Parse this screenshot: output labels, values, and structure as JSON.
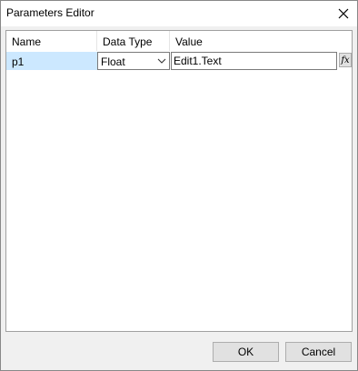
{
  "window": {
    "title": "Parameters Editor"
  },
  "grid": {
    "columns": [
      "Name",
      "Data Type",
      "Value"
    ],
    "rows": [
      {
        "name": "p1",
        "data_type": "Float",
        "value": "Edit1.Text",
        "expr_button": "fx"
      }
    ]
  },
  "buttons": {
    "ok": "OK",
    "cancel": "Cancel"
  },
  "icons": {
    "close": "close-icon",
    "dropdown": "chevron-down-icon",
    "expression": "function-icon"
  }
}
